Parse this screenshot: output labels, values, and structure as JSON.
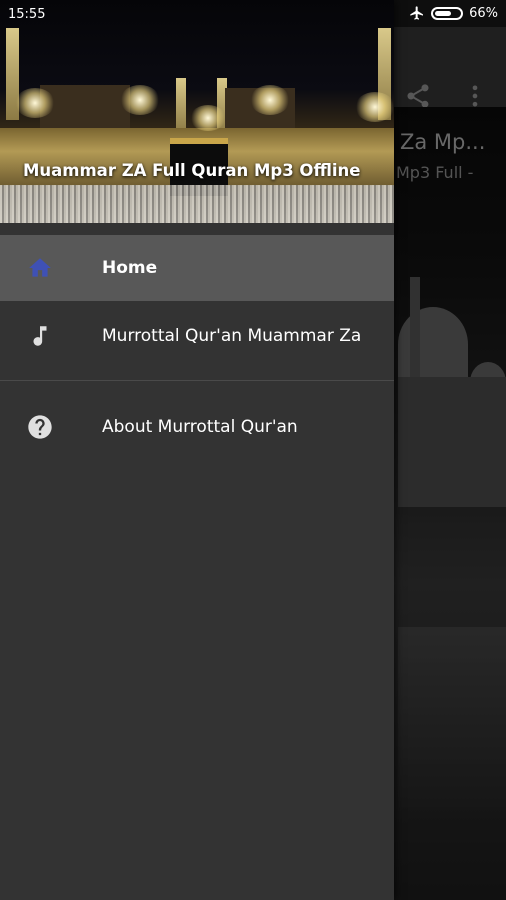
{
  "status_bar": {
    "time": "15:55",
    "battery_percent": "66%",
    "battery_level": 0.66
  },
  "background_app": {
    "title": "Za Mp...",
    "subtitle": "Mp3 Full -",
    "icons": [
      "share-icon",
      "more-vert-icon"
    ]
  },
  "drawer": {
    "header_title": "Muammar ZA Full Quran Mp3 Offline",
    "items": [
      {
        "label": "Home",
        "icon": "home-icon",
        "selected": true
      },
      {
        "label": "Murrottal Qur'an Muammar Za",
        "icon": "music-note-icon",
        "selected": false
      },
      {
        "label": "About Murrottal Qur'an",
        "icon": "help-circle-icon",
        "selected": false
      }
    ]
  },
  "colors": {
    "drawer_bg": "#333333",
    "selected_bg": "#585858",
    "home_icon": "#3f51b5",
    "icon_default": "#e0e0e0"
  }
}
